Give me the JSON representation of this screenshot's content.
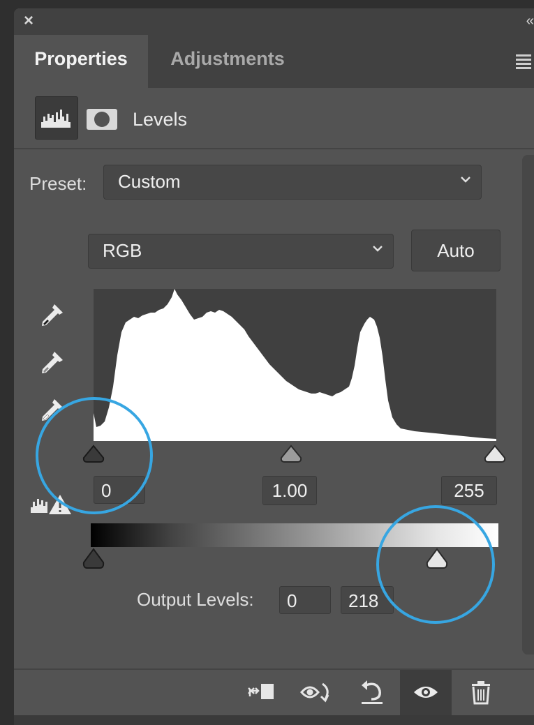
{
  "window": {
    "close_glyph": "×",
    "collapse_glyph": "‹‹"
  },
  "tabs": [
    {
      "label": "Properties",
      "active": true
    },
    {
      "label": "Adjustments",
      "active": false
    }
  ],
  "levels_header": {
    "title": "Levels"
  },
  "preset": {
    "label": "Preset:",
    "value": "Custom"
  },
  "channel": {
    "value": "RGB"
  },
  "auto_button": {
    "label": "Auto"
  },
  "input_levels": {
    "black": "0",
    "gamma": "1.00",
    "white": "255"
  },
  "output_levels": {
    "label": "Output Levels:",
    "black": "0",
    "white": "218"
  },
  "colors": {
    "panel_bg": "#535353",
    "accent_circle": "#37a6e2",
    "histogram_fill": "#ffffff"
  },
  "icons": [
    "histogram-icon",
    "mask-icon",
    "black-point-eyedropper-icon",
    "gray-point-eyedropper-icon",
    "white-point-eyedropper-icon",
    "clipping-warning-icon",
    "clip-to-layer-icon",
    "view-previous-state-icon",
    "reset-icon",
    "visibility-eye-icon",
    "trash-icon",
    "menu-icon"
  ]
}
